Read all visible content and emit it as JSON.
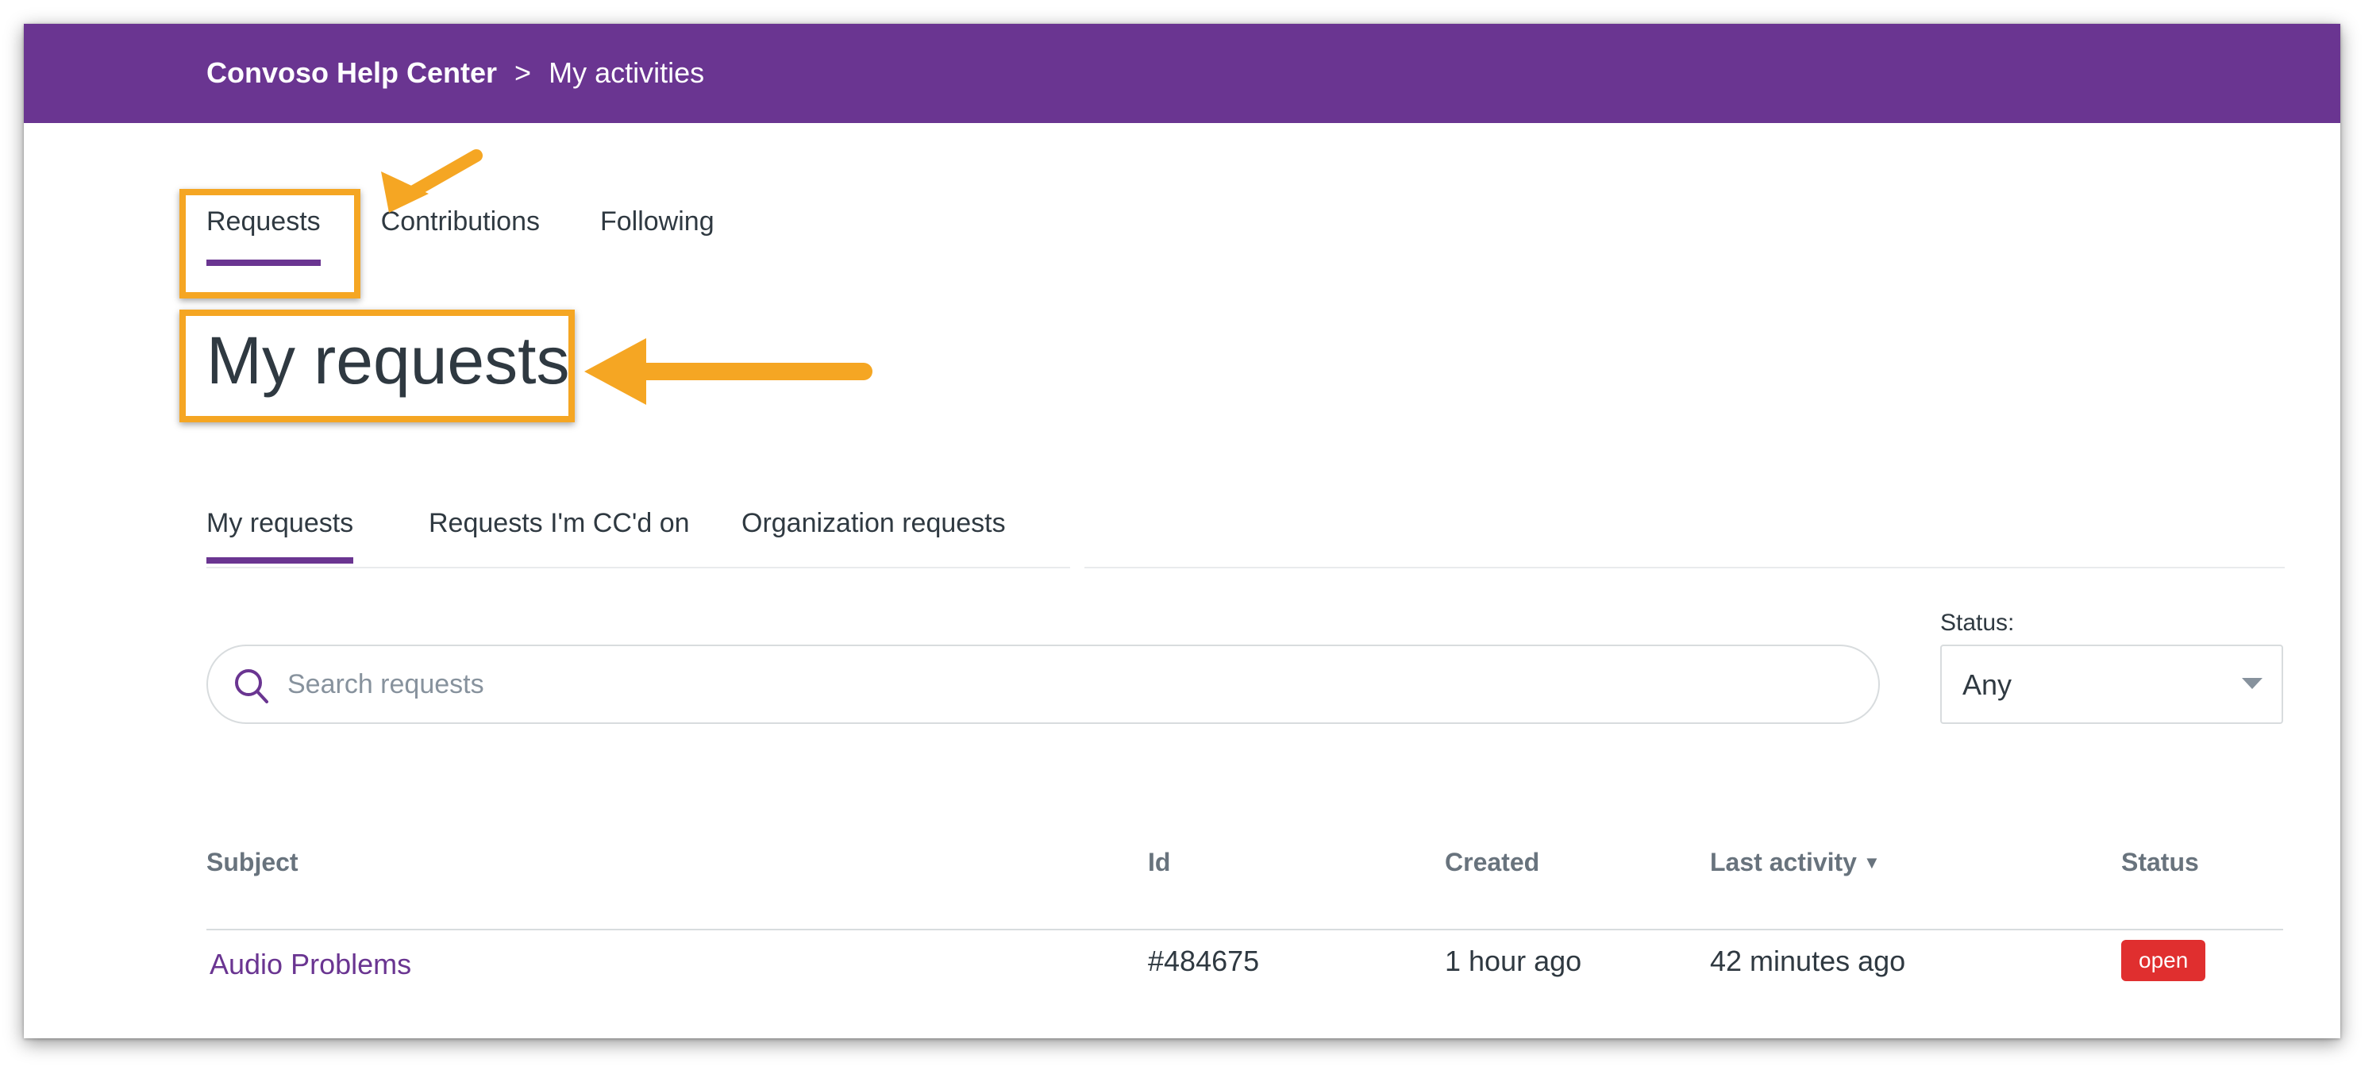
{
  "breadcrumb": {
    "home": "Convoso Help Center",
    "separator": ">",
    "current": "My activities"
  },
  "activity_tabs": [
    {
      "label": "Requests",
      "active": true
    },
    {
      "label": "Contributions",
      "active": false
    },
    {
      "label": "Following",
      "active": false
    }
  ],
  "page_title": "My requests",
  "request_tabs": [
    {
      "label": "My requests",
      "active": true
    },
    {
      "label": "Requests I'm CC'd on",
      "active": false
    },
    {
      "label": "Organization requests",
      "active": false
    }
  ],
  "search": {
    "placeholder": "Search requests",
    "icon": "search-icon"
  },
  "status_filter": {
    "label": "Status:",
    "value": "Any"
  },
  "table": {
    "columns": [
      "Subject",
      "Id",
      "Created",
      "Last activity",
      "Status"
    ],
    "sort_indicator": "▼",
    "rows": [
      {
        "subject": "Audio Problems",
        "id": "#484675",
        "created": "1 hour ago",
        "last_activity": "42 minutes ago",
        "status": "open"
      }
    ]
  },
  "colors": {
    "brand": "#6a3591",
    "annotation": "#f5a623",
    "status_open": "#e02f2f"
  }
}
